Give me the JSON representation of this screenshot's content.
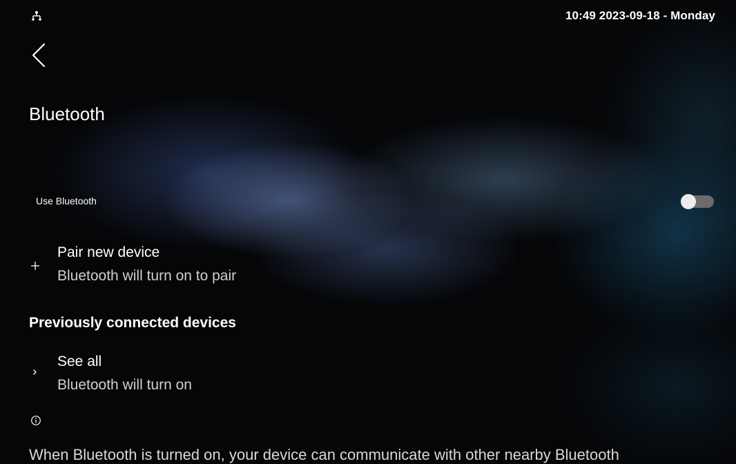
{
  "status_bar": {
    "icon": "network-icon",
    "clock": "10:49  2023-09-18 - Monday"
  },
  "header": {
    "back_icon": "back-arrow-icon",
    "title": "Bluetooth"
  },
  "use_bluetooth": {
    "label": "Use Bluetooth",
    "enabled": false
  },
  "pair_new_device": {
    "icon": "plus-icon",
    "title": "Pair new device",
    "summary": "Bluetooth will turn on to pair"
  },
  "previously_connected": {
    "header": "Previously connected devices",
    "see_all": {
      "icon": "chevron-right-icon",
      "title": "See all",
      "summary": "Bluetooth will turn on"
    }
  },
  "footer": {
    "icon": "info-icon",
    "text": "When Bluetooth is turned on, your device can communicate with other nearby Bluetooth"
  },
  "colors": {
    "background": "#050608",
    "text_primary": "#ffffff",
    "text_secondary": "#d0d0d0",
    "switch_track_off": "#6b6b6b",
    "switch_thumb_off": "#ececec"
  }
}
